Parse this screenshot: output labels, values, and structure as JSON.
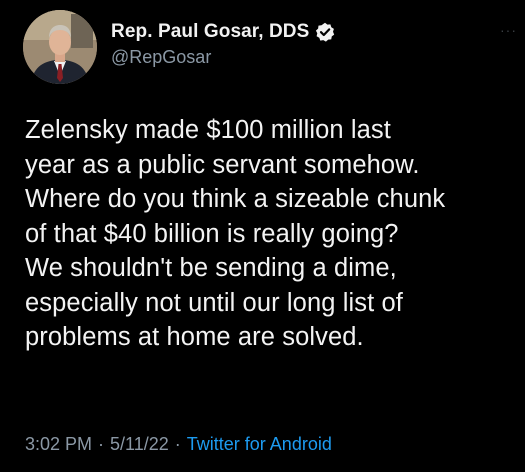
{
  "author": {
    "display_name": "Rep. Paul Gosar, DDS",
    "handle": "@RepGosar",
    "verified_icon": "verified-badge-icon"
  },
  "menu": {
    "more_label": "···"
  },
  "tweet": {
    "lines": [
      "Zelensky made $100 million last",
      "year as a public servant somehow.",
      "Where do you think a sizeable chunk",
      "of that $40 billion is really going?",
      "We shouldn't be sending a dime,",
      "especially not until our long list of",
      "problems at home are solved."
    ]
  },
  "meta": {
    "time": "3:02 PM",
    "date": "5/11/22",
    "separator": "·",
    "source": "Twitter for Android"
  },
  "colors": {
    "background": "#000000",
    "text": "#f3f3f3",
    "secondary": "#8b98a5",
    "link": "#1d9bf0"
  }
}
